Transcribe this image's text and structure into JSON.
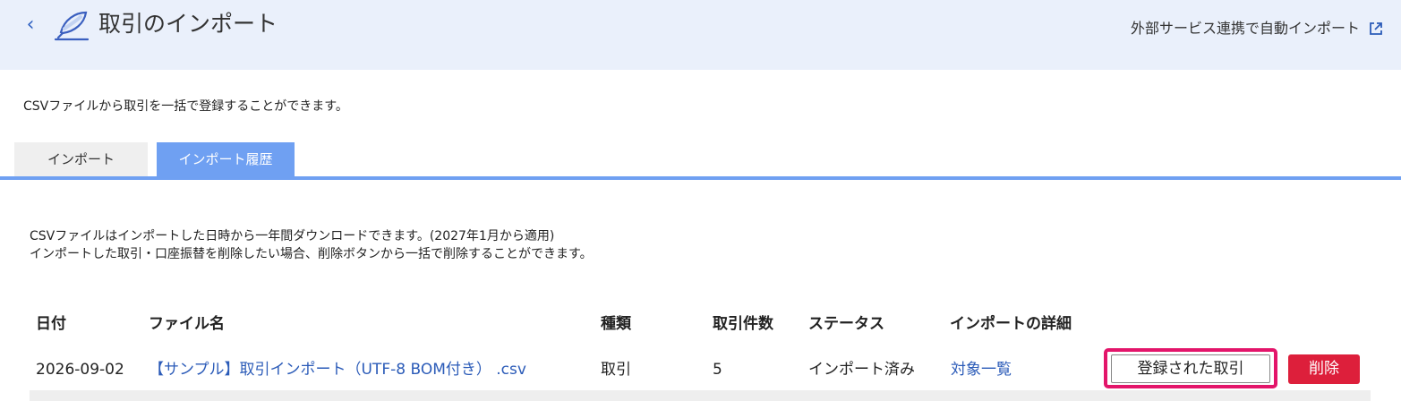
{
  "header": {
    "title": "取引のインポート",
    "external_link": "外部サービス連携で自動インポート"
  },
  "intro": "CSVファイルから取引を一括で登録することができます。",
  "tabs": [
    {
      "label": "インポート",
      "active": false
    },
    {
      "label": "インポート履歴",
      "active": true
    }
  ],
  "notes": [
    "CSVファイルはインポートした日時から一年間ダウンロードできます。(2027年1月から適用)",
    "インポートした取引・口座振替を削除したい場合、削除ボタンから一括で削除することができます。"
  ],
  "table": {
    "headers": [
      "日付",
      "ファイル名",
      "種類",
      "取引件数",
      "ステータス",
      "インポートの詳細"
    ],
    "rows": [
      {
        "date": "2026-09-02",
        "file_name": "【サンプル】取引インポート（UTF-8 BOM付き） .csv",
        "type": "取引",
        "count": "5",
        "status": "インポート済み",
        "detail_link": "対象一覧",
        "registered_button": "登録された取引",
        "delete_button": "削除"
      }
    ]
  },
  "colors": {
    "header_bg": "#eaf0fb",
    "tab_active": "#6fa0f2",
    "link": "#2b5bb8",
    "delete": "#dd1f3b",
    "highlight": "#e3156a"
  },
  "icons": {
    "back": "chevron-left-icon",
    "logo": "feather-logo-icon",
    "external": "external-link-icon"
  }
}
